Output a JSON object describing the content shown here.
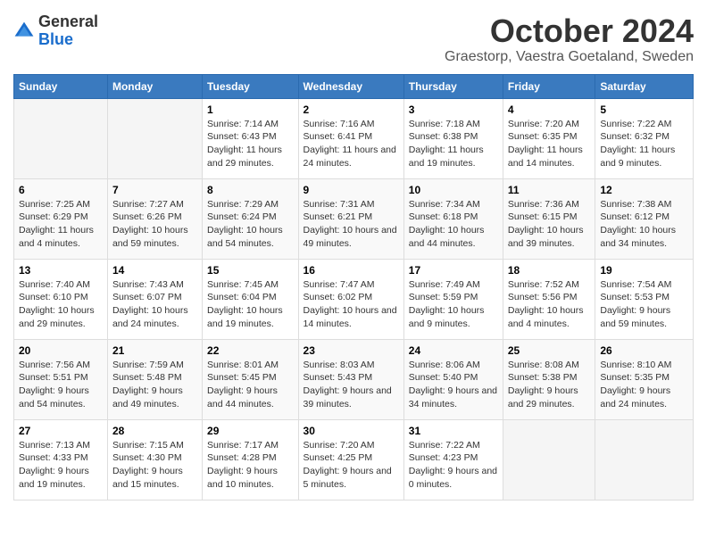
{
  "logo": {
    "general": "General",
    "blue": "Blue"
  },
  "header": {
    "month": "October 2024",
    "location": "Graestorp, Vaestra Goetaland, Sweden"
  },
  "weekdays": [
    "Sunday",
    "Monday",
    "Tuesday",
    "Wednesday",
    "Thursday",
    "Friday",
    "Saturday"
  ],
  "weeks": [
    [
      {
        "day": "",
        "info": ""
      },
      {
        "day": "",
        "info": ""
      },
      {
        "day": "1",
        "info": "Sunrise: 7:14 AM\nSunset: 6:43 PM\nDaylight: 11 hours and 29 minutes."
      },
      {
        "day": "2",
        "info": "Sunrise: 7:16 AM\nSunset: 6:41 PM\nDaylight: 11 hours and 24 minutes."
      },
      {
        "day": "3",
        "info": "Sunrise: 7:18 AM\nSunset: 6:38 PM\nDaylight: 11 hours and 19 minutes."
      },
      {
        "day": "4",
        "info": "Sunrise: 7:20 AM\nSunset: 6:35 PM\nDaylight: 11 hours and 14 minutes."
      },
      {
        "day": "5",
        "info": "Sunrise: 7:22 AM\nSunset: 6:32 PM\nDaylight: 11 hours and 9 minutes."
      }
    ],
    [
      {
        "day": "6",
        "info": "Sunrise: 7:25 AM\nSunset: 6:29 PM\nDaylight: 11 hours and 4 minutes."
      },
      {
        "day": "7",
        "info": "Sunrise: 7:27 AM\nSunset: 6:26 PM\nDaylight: 10 hours and 59 minutes."
      },
      {
        "day": "8",
        "info": "Sunrise: 7:29 AM\nSunset: 6:24 PM\nDaylight: 10 hours and 54 minutes."
      },
      {
        "day": "9",
        "info": "Sunrise: 7:31 AM\nSunset: 6:21 PM\nDaylight: 10 hours and 49 minutes."
      },
      {
        "day": "10",
        "info": "Sunrise: 7:34 AM\nSunset: 6:18 PM\nDaylight: 10 hours and 44 minutes."
      },
      {
        "day": "11",
        "info": "Sunrise: 7:36 AM\nSunset: 6:15 PM\nDaylight: 10 hours and 39 minutes."
      },
      {
        "day": "12",
        "info": "Sunrise: 7:38 AM\nSunset: 6:12 PM\nDaylight: 10 hours and 34 minutes."
      }
    ],
    [
      {
        "day": "13",
        "info": "Sunrise: 7:40 AM\nSunset: 6:10 PM\nDaylight: 10 hours and 29 minutes."
      },
      {
        "day": "14",
        "info": "Sunrise: 7:43 AM\nSunset: 6:07 PM\nDaylight: 10 hours and 24 minutes."
      },
      {
        "day": "15",
        "info": "Sunrise: 7:45 AM\nSunset: 6:04 PM\nDaylight: 10 hours and 19 minutes."
      },
      {
        "day": "16",
        "info": "Sunrise: 7:47 AM\nSunset: 6:02 PM\nDaylight: 10 hours and 14 minutes."
      },
      {
        "day": "17",
        "info": "Sunrise: 7:49 AM\nSunset: 5:59 PM\nDaylight: 10 hours and 9 minutes."
      },
      {
        "day": "18",
        "info": "Sunrise: 7:52 AM\nSunset: 5:56 PM\nDaylight: 10 hours and 4 minutes."
      },
      {
        "day": "19",
        "info": "Sunrise: 7:54 AM\nSunset: 5:53 PM\nDaylight: 9 hours and 59 minutes."
      }
    ],
    [
      {
        "day": "20",
        "info": "Sunrise: 7:56 AM\nSunset: 5:51 PM\nDaylight: 9 hours and 54 minutes."
      },
      {
        "day": "21",
        "info": "Sunrise: 7:59 AM\nSunset: 5:48 PM\nDaylight: 9 hours and 49 minutes."
      },
      {
        "day": "22",
        "info": "Sunrise: 8:01 AM\nSunset: 5:45 PM\nDaylight: 9 hours and 44 minutes."
      },
      {
        "day": "23",
        "info": "Sunrise: 8:03 AM\nSunset: 5:43 PM\nDaylight: 9 hours and 39 minutes."
      },
      {
        "day": "24",
        "info": "Sunrise: 8:06 AM\nSunset: 5:40 PM\nDaylight: 9 hours and 34 minutes."
      },
      {
        "day": "25",
        "info": "Sunrise: 8:08 AM\nSunset: 5:38 PM\nDaylight: 9 hours and 29 minutes."
      },
      {
        "day": "26",
        "info": "Sunrise: 8:10 AM\nSunset: 5:35 PM\nDaylight: 9 hours and 24 minutes."
      }
    ],
    [
      {
        "day": "27",
        "info": "Sunrise: 7:13 AM\nSunset: 4:33 PM\nDaylight: 9 hours and 19 minutes."
      },
      {
        "day": "28",
        "info": "Sunrise: 7:15 AM\nSunset: 4:30 PM\nDaylight: 9 hours and 15 minutes."
      },
      {
        "day": "29",
        "info": "Sunrise: 7:17 AM\nSunset: 4:28 PM\nDaylight: 9 hours and 10 minutes."
      },
      {
        "day": "30",
        "info": "Sunrise: 7:20 AM\nSunset: 4:25 PM\nDaylight: 9 hours and 5 minutes."
      },
      {
        "day": "31",
        "info": "Sunrise: 7:22 AM\nSunset: 4:23 PM\nDaylight: 9 hours and 0 minutes."
      },
      {
        "day": "",
        "info": ""
      },
      {
        "day": "",
        "info": ""
      }
    ]
  ]
}
